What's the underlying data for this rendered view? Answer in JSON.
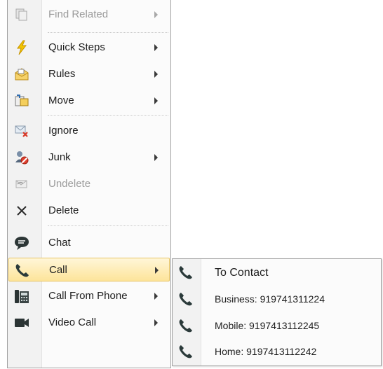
{
  "menu": {
    "items": [
      {
        "label": "Find Related",
        "icon": "find-related-icon",
        "submenu": true,
        "disabled": true
      },
      {
        "label": "Quick Steps",
        "icon": "lightning-icon",
        "submenu": true
      },
      {
        "label": "Rules",
        "icon": "rules-icon",
        "submenu": true
      },
      {
        "label": "Move",
        "icon": "move-folder-icon",
        "submenu": true
      },
      {
        "label": "Ignore",
        "icon": "ignore-icon",
        "submenu": false
      },
      {
        "label": "Junk",
        "icon": "junk-icon",
        "submenu": true
      },
      {
        "label": "Undelete",
        "icon": "undelete-icon",
        "submenu": false,
        "disabled": true
      },
      {
        "label": "Delete",
        "icon": "delete-x-icon",
        "submenu": false
      },
      {
        "label": "Chat",
        "icon": "chat-bubble-icon",
        "submenu": false
      },
      {
        "label": "Call",
        "icon": "phone-icon",
        "submenu": true,
        "highlighted": true
      },
      {
        "label": "Call From Phone",
        "icon": "desk-phone-icon",
        "submenu": true
      },
      {
        "label": "Video Call",
        "icon": "video-camera-icon",
        "submenu": true
      }
    ]
  },
  "call_submenu": {
    "items": [
      {
        "label": "To Contact",
        "icon": "phone-icon"
      },
      {
        "label": "Business: 919741311224",
        "icon": "phone-icon"
      },
      {
        "label": "Mobile: 9197413112245",
        "icon": "phone-icon"
      },
      {
        "label": "Home: 9197413112242",
        "icon": "phone-icon"
      }
    ]
  },
  "colors": {
    "highlight_top": "#fff6d8",
    "highlight_bottom": "#fde49a",
    "highlight_border": "#e7c465",
    "icon_phone": "#2b3a3a",
    "icon_lightning": "#e8b400"
  }
}
